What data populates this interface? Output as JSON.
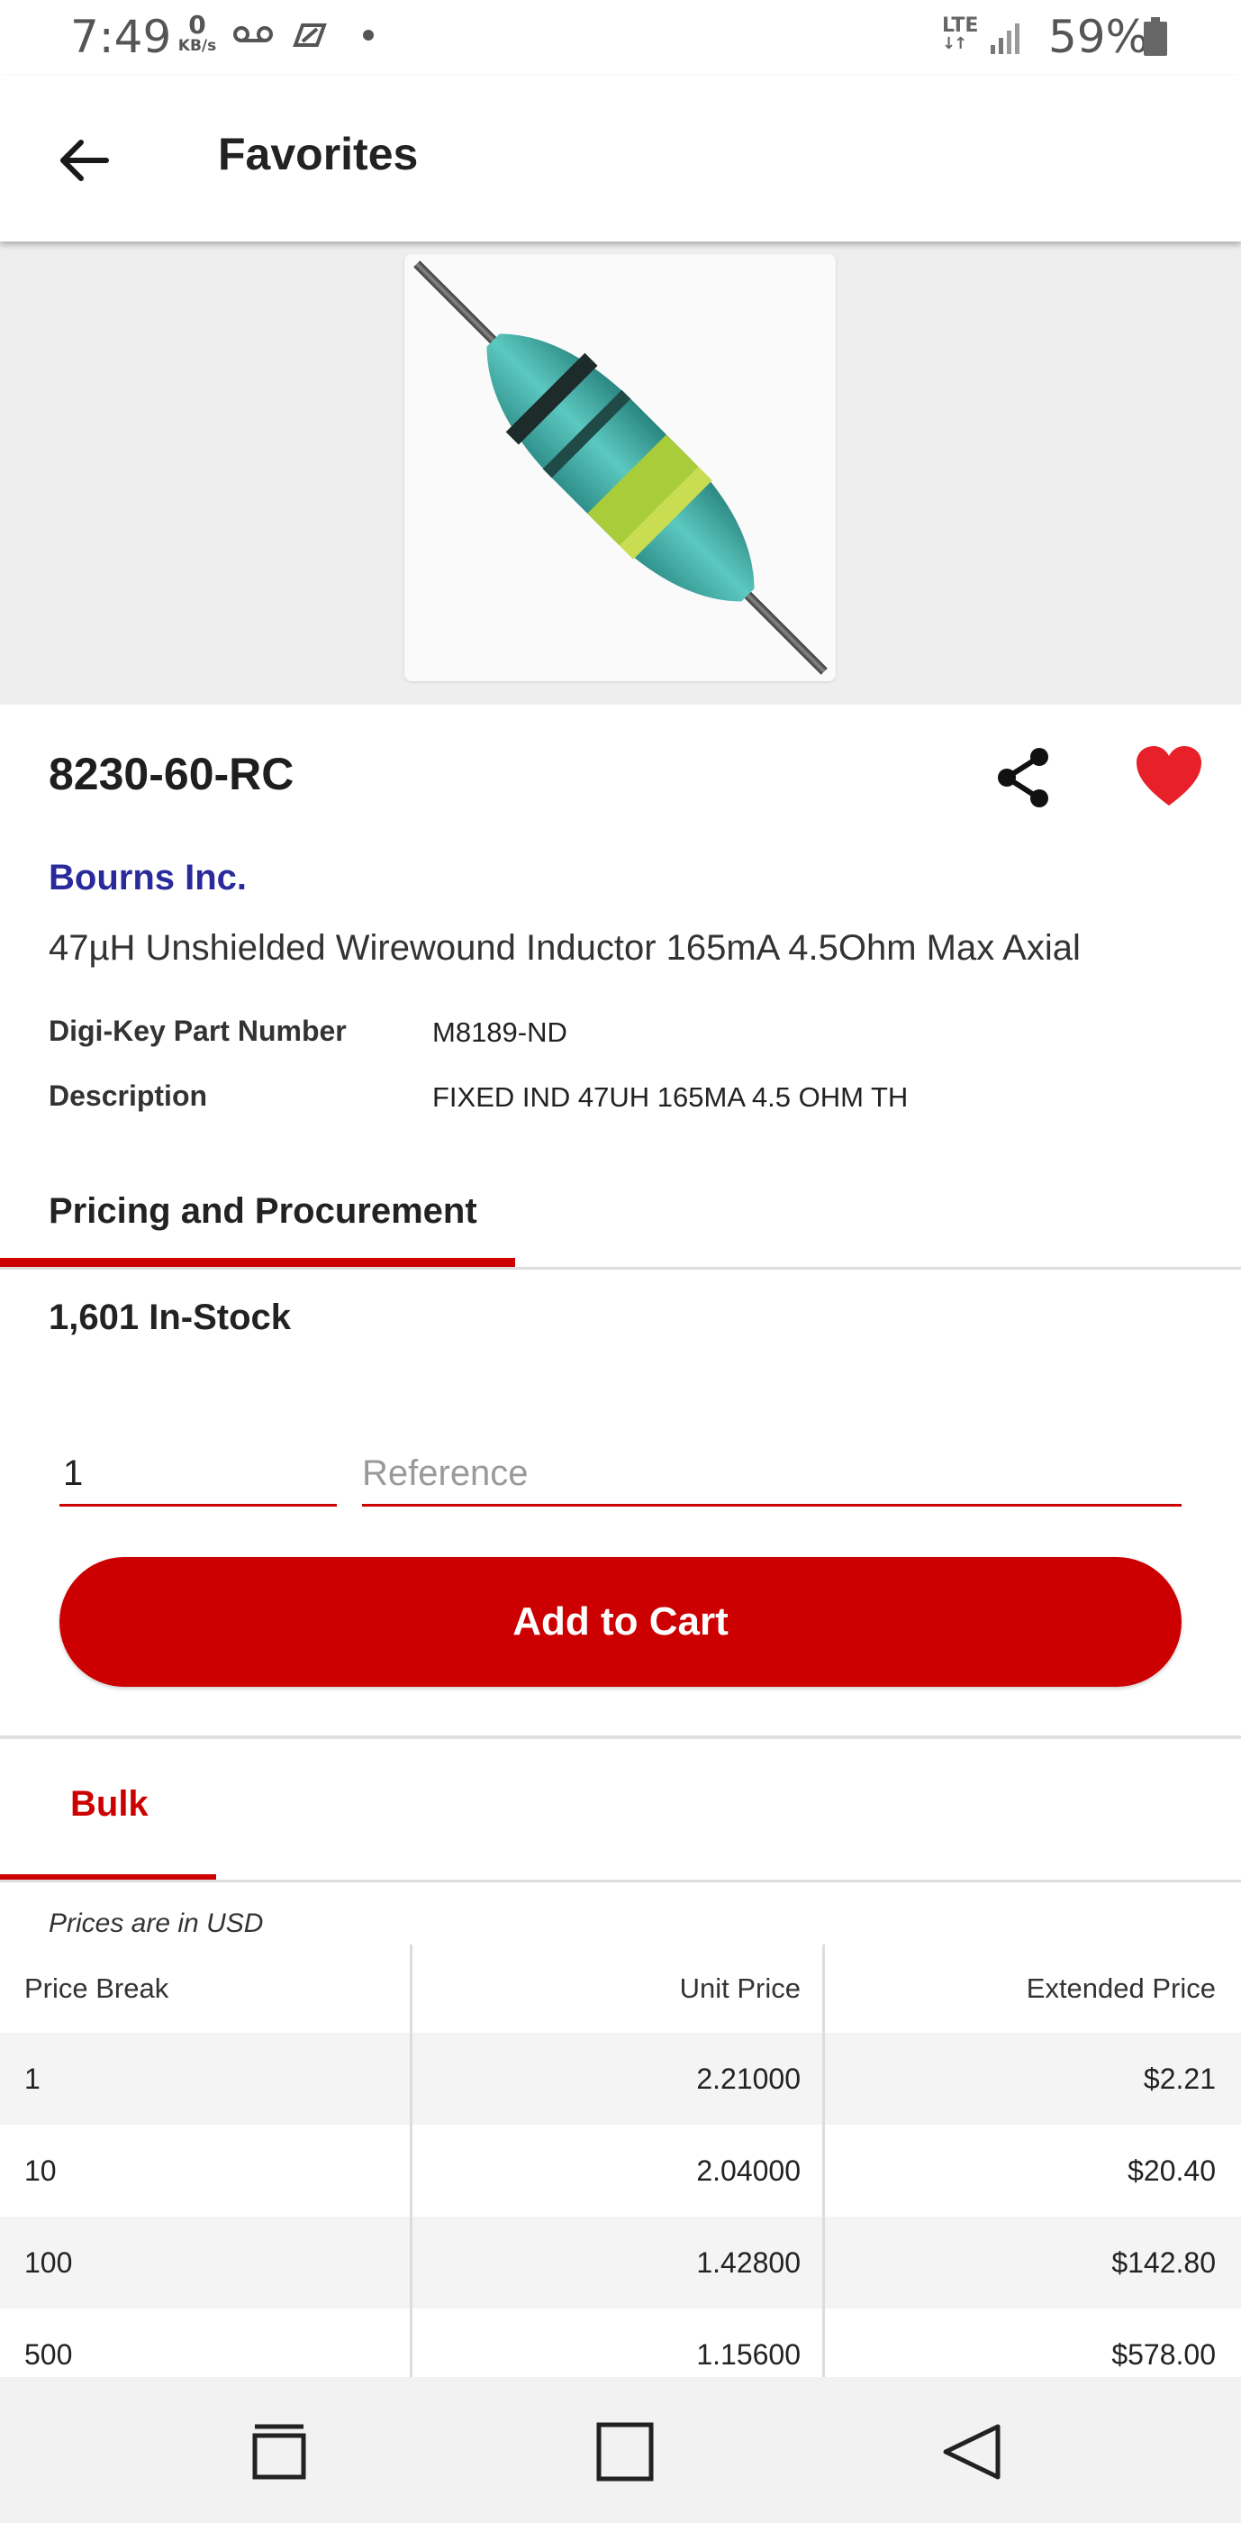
{
  "status_bar": {
    "time": "7:49",
    "data_rate_value": "0",
    "data_rate_unit": "KB/s",
    "network": "LTE",
    "battery": "59%"
  },
  "app_bar": {
    "title": "Favorites"
  },
  "product": {
    "part_number": "8230-60-RC",
    "manufacturer": "Bourns Inc.",
    "headline": "47µH Unshielded Wirewound Inductor 165mA 4.5Ohm Max Axial",
    "specs": [
      {
        "label": "Digi-Key Part Number",
        "value": "M8189-ND"
      },
      {
        "label": "Description",
        "value": "FIXED IND 47UH 165MA 4.5 OHM TH"
      }
    ]
  },
  "pricing": {
    "tab_label": "Pricing and Procurement",
    "stock": "1,601 In-Stock",
    "quantity_value": "1",
    "reference_placeholder": "Reference",
    "add_to_cart_label": "Add to Cart",
    "package_tab": "Bulk",
    "currency_note": "Prices are in USD",
    "columns": [
      "Price Break",
      "Unit Price",
      "Extended Price"
    ],
    "rows": [
      [
        "1",
        "2.21000",
        "$2.21"
      ],
      [
        "10",
        "2.04000",
        "$20.40"
      ],
      [
        "100",
        "1.42800",
        "$142.80"
      ],
      [
        "500",
        "1.15600",
        "$578.00"
      ]
    ]
  },
  "colors": {
    "accent": "#cc0000",
    "manufacturer_link": "#2a2a9c",
    "favorite": "#e8202a"
  },
  "icons": {
    "back": "arrow-left-icon",
    "share": "share-icon",
    "favorite": "heart-icon",
    "nav_recents": "recents-icon",
    "nav_home": "home-icon",
    "nav_back": "nav-back-icon"
  }
}
